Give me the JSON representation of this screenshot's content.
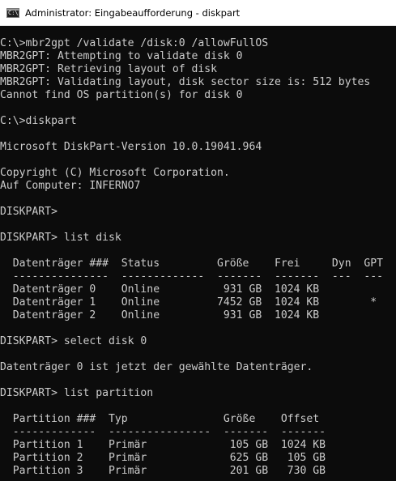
{
  "window": {
    "title": "Administrator: Eingabeaufforderung - diskpart",
    "icon": "cmd-icon",
    "icon_glyph": "C:\\"
  },
  "console": {
    "lines": [
      "C:\\>mbr2gpt /validate /disk:0 /allowFullOS",
      "MBR2GPT: Attempting to validate disk 0",
      "MBR2GPT: Retrieving layout of disk",
      "MBR2GPT: Validating layout, disk sector size is: 512 bytes",
      "Cannot find OS partition(s) for disk 0",
      "",
      "C:\\>diskpart",
      "",
      "Microsoft DiskPart-Version 10.0.19041.964",
      "",
      "Copyright (C) Microsoft Corporation.",
      "Auf Computer: INFERNO7",
      "",
      "DISKPART>",
      "",
      "DISKPART> list disk",
      "",
      "  Datenträger ###  Status         Größe    Frei     Dyn  GPT",
      "  ---------------  -------------  -------  -------  ---  ---",
      "  Datenträger 0    Online          931 GB  1024 KB",
      "  Datenträger 1    Online         7452 GB  1024 KB        *",
      "  Datenträger 2    Online          931 GB  1024 KB",
      "",
      "DISKPART> select disk 0",
      "",
      "Datenträger 0 ist jetzt der gewählte Datenträger.",
      "",
      "DISKPART> list partition",
      "",
      "  Partition ###  Typ               Größe    Offset",
      "  -------------  ----------------  -------  -------",
      "  Partition 1    Primär             105 GB  1024 KB",
      "  Partition 2    Primär             625 GB   105 GB",
      "  Partition 3    Primär             201 GB   730 GB"
    ]
  },
  "colors": {
    "background": "#0c0c0c",
    "text": "#cccccc",
    "titlebar": "#ffffff"
  }
}
